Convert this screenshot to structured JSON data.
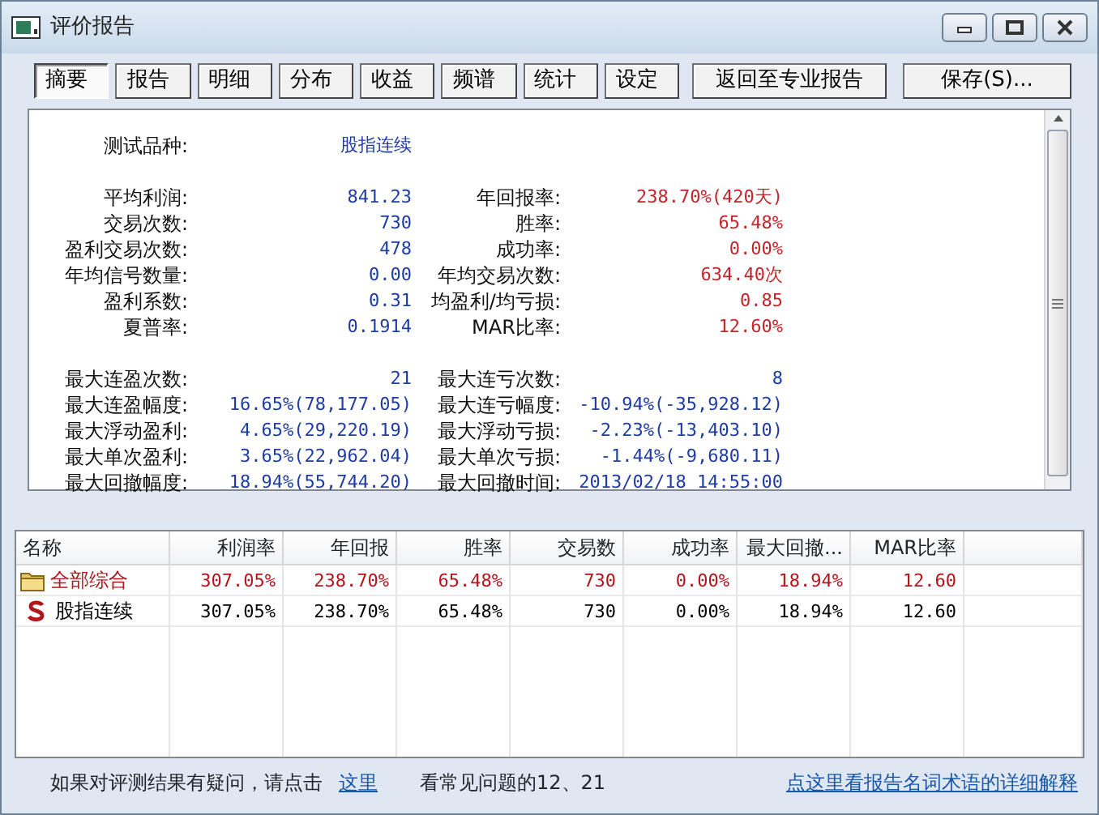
{
  "window": {
    "title": "评价报告"
  },
  "tabs": [
    {
      "label": "摘要",
      "selected": true
    },
    {
      "label": "报告",
      "selected": false
    },
    {
      "label": "明细",
      "selected": false
    },
    {
      "label": "分布",
      "selected": false
    },
    {
      "label": "收益",
      "selected": false
    },
    {
      "label": "频谱",
      "selected": false
    },
    {
      "label": "统计",
      "selected": false
    },
    {
      "label": "设定",
      "selected": false
    }
  ],
  "actions": [
    "返回至专业报告",
    "保存(S)..."
  ],
  "summary": [
    [
      {
        "left": {
          "label": "测试品种:",
          "value": "股指连续",
          "color": "#1f3da0"
        }
      }
    ],
    [
      {
        "left": {
          "label": "平均利润:",
          "value": "841.23",
          "color": "#1f3da0"
        },
        "right": {
          "label": "年回报率:",
          "value": "238.70%(420天)",
          "color": "#c0262c"
        }
      },
      {
        "left": {
          "label": "交易次数:",
          "value": "730",
          "color": "#1f3da0"
        },
        "right": {
          "label": "胜率:",
          "value": "65.48%",
          "color": "#c0262c"
        }
      },
      {
        "left": {
          "label": "盈利交易次数:",
          "value": "478",
          "color": "#1f3da0"
        },
        "right": {
          "label": "成功率:",
          "value": "0.00%",
          "color": "#c0262c"
        }
      },
      {
        "left": {
          "label": "年均信号数量:",
          "value": "0.00",
          "color": "#1f3da0"
        },
        "right": {
          "label": "年均交易次数:",
          "value": "634.40次",
          "color": "#c0262c"
        }
      },
      {
        "left": {
          "label": "盈利系数:",
          "value": "0.31",
          "color": "#1f3da0"
        },
        "right": {
          "label": "均盈利/均亏损:",
          "value": "0.85",
          "color": "#c0262c"
        }
      },
      {
        "left": {
          "label": "夏普率:",
          "value": "0.1914",
          "color": "#1f3da0"
        },
        "right": {
          "label": "MAR比率:",
          "value": "12.60%",
          "color": "#c0262c"
        }
      }
    ],
    [
      {
        "left": {
          "label": "最大连盈次数:",
          "value": "21",
          "color": "#1f3da0"
        },
        "right": {
          "label": "最大连亏次数:",
          "value": "8",
          "color": "#1f3da0"
        }
      },
      {
        "left": {
          "label": "最大连盈幅度:",
          "value": "16.65%(78,177.05)",
          "color": "#1f3da0"
        },
        "right": {
          "label": "最大连亏幅度:",
          "value": "-10.94%(-35,928.12)",
          "color": "#1f3da0"
        }
      },
      {
        "left": {
          "label": "最大浮动盈利:",
          "value": "4.65%(29,220.19)",
          "color": "#1f3da0"
        },
        "right": {
          "label": "最大浮动亏损:",
          "value": "-2.23%(-13,403.10)",
          "color": "#1f3da0"
        }
      },
      {
        "left": {
          "label": "最大单次盈利:",
          "value": "3.65%(22,962.04)",
          "color": "#1f3da0"
        },
        "right": {
          "label": "最大单次亏损:",
          "value": "-1.44%(-9,680.11)",
          "color": "#1f3da0"
        }
      },
      {
        "left": {
          "label": "最大回撤幅度:",
          "value": "18.94%(55,744.20)",
          "color": "#1f3da0"
        },
        "right": {
          "label": "最大回撤时间:",
          "value": "2013/02/18 14:55:00",
          "color": "#1f3da0"
        }
      }
    ]
  ],
  "table": {
    "columns": [
      "名称",
      "利润率",
      "年回报",
      "胜率",
      "交易数",
      "成功率",
      "最大回撤...",
      "MAR比率"
    ],
    "rows": [
      {
        "kind": "folder",
        "color": "#b0161c",
        "cells": [
          "全部综合",
          "307.05%",
          "238.70%",
          "65.48%",
          "730",
          "0.00%",
          "18.94%",
          "12.60"
        ]
      },
      {
        "kind": "strategy",
        "color": "#000000",
        "cells": [
          "股指连续",
          "307.05%",
          "238.70%",
          "65.48%",
          "730",
          "0.00%",
          "18.94%",
          "12.60"
        ]
      }
    ]
  },
  "footer": {
    "text": "如果对评测结果有疑问，请点击",
    "link": "这里",
    "note": "看常见问题的12、21",
    "help_link": "点这里看报告名词术语的详细解释"
  }
}
